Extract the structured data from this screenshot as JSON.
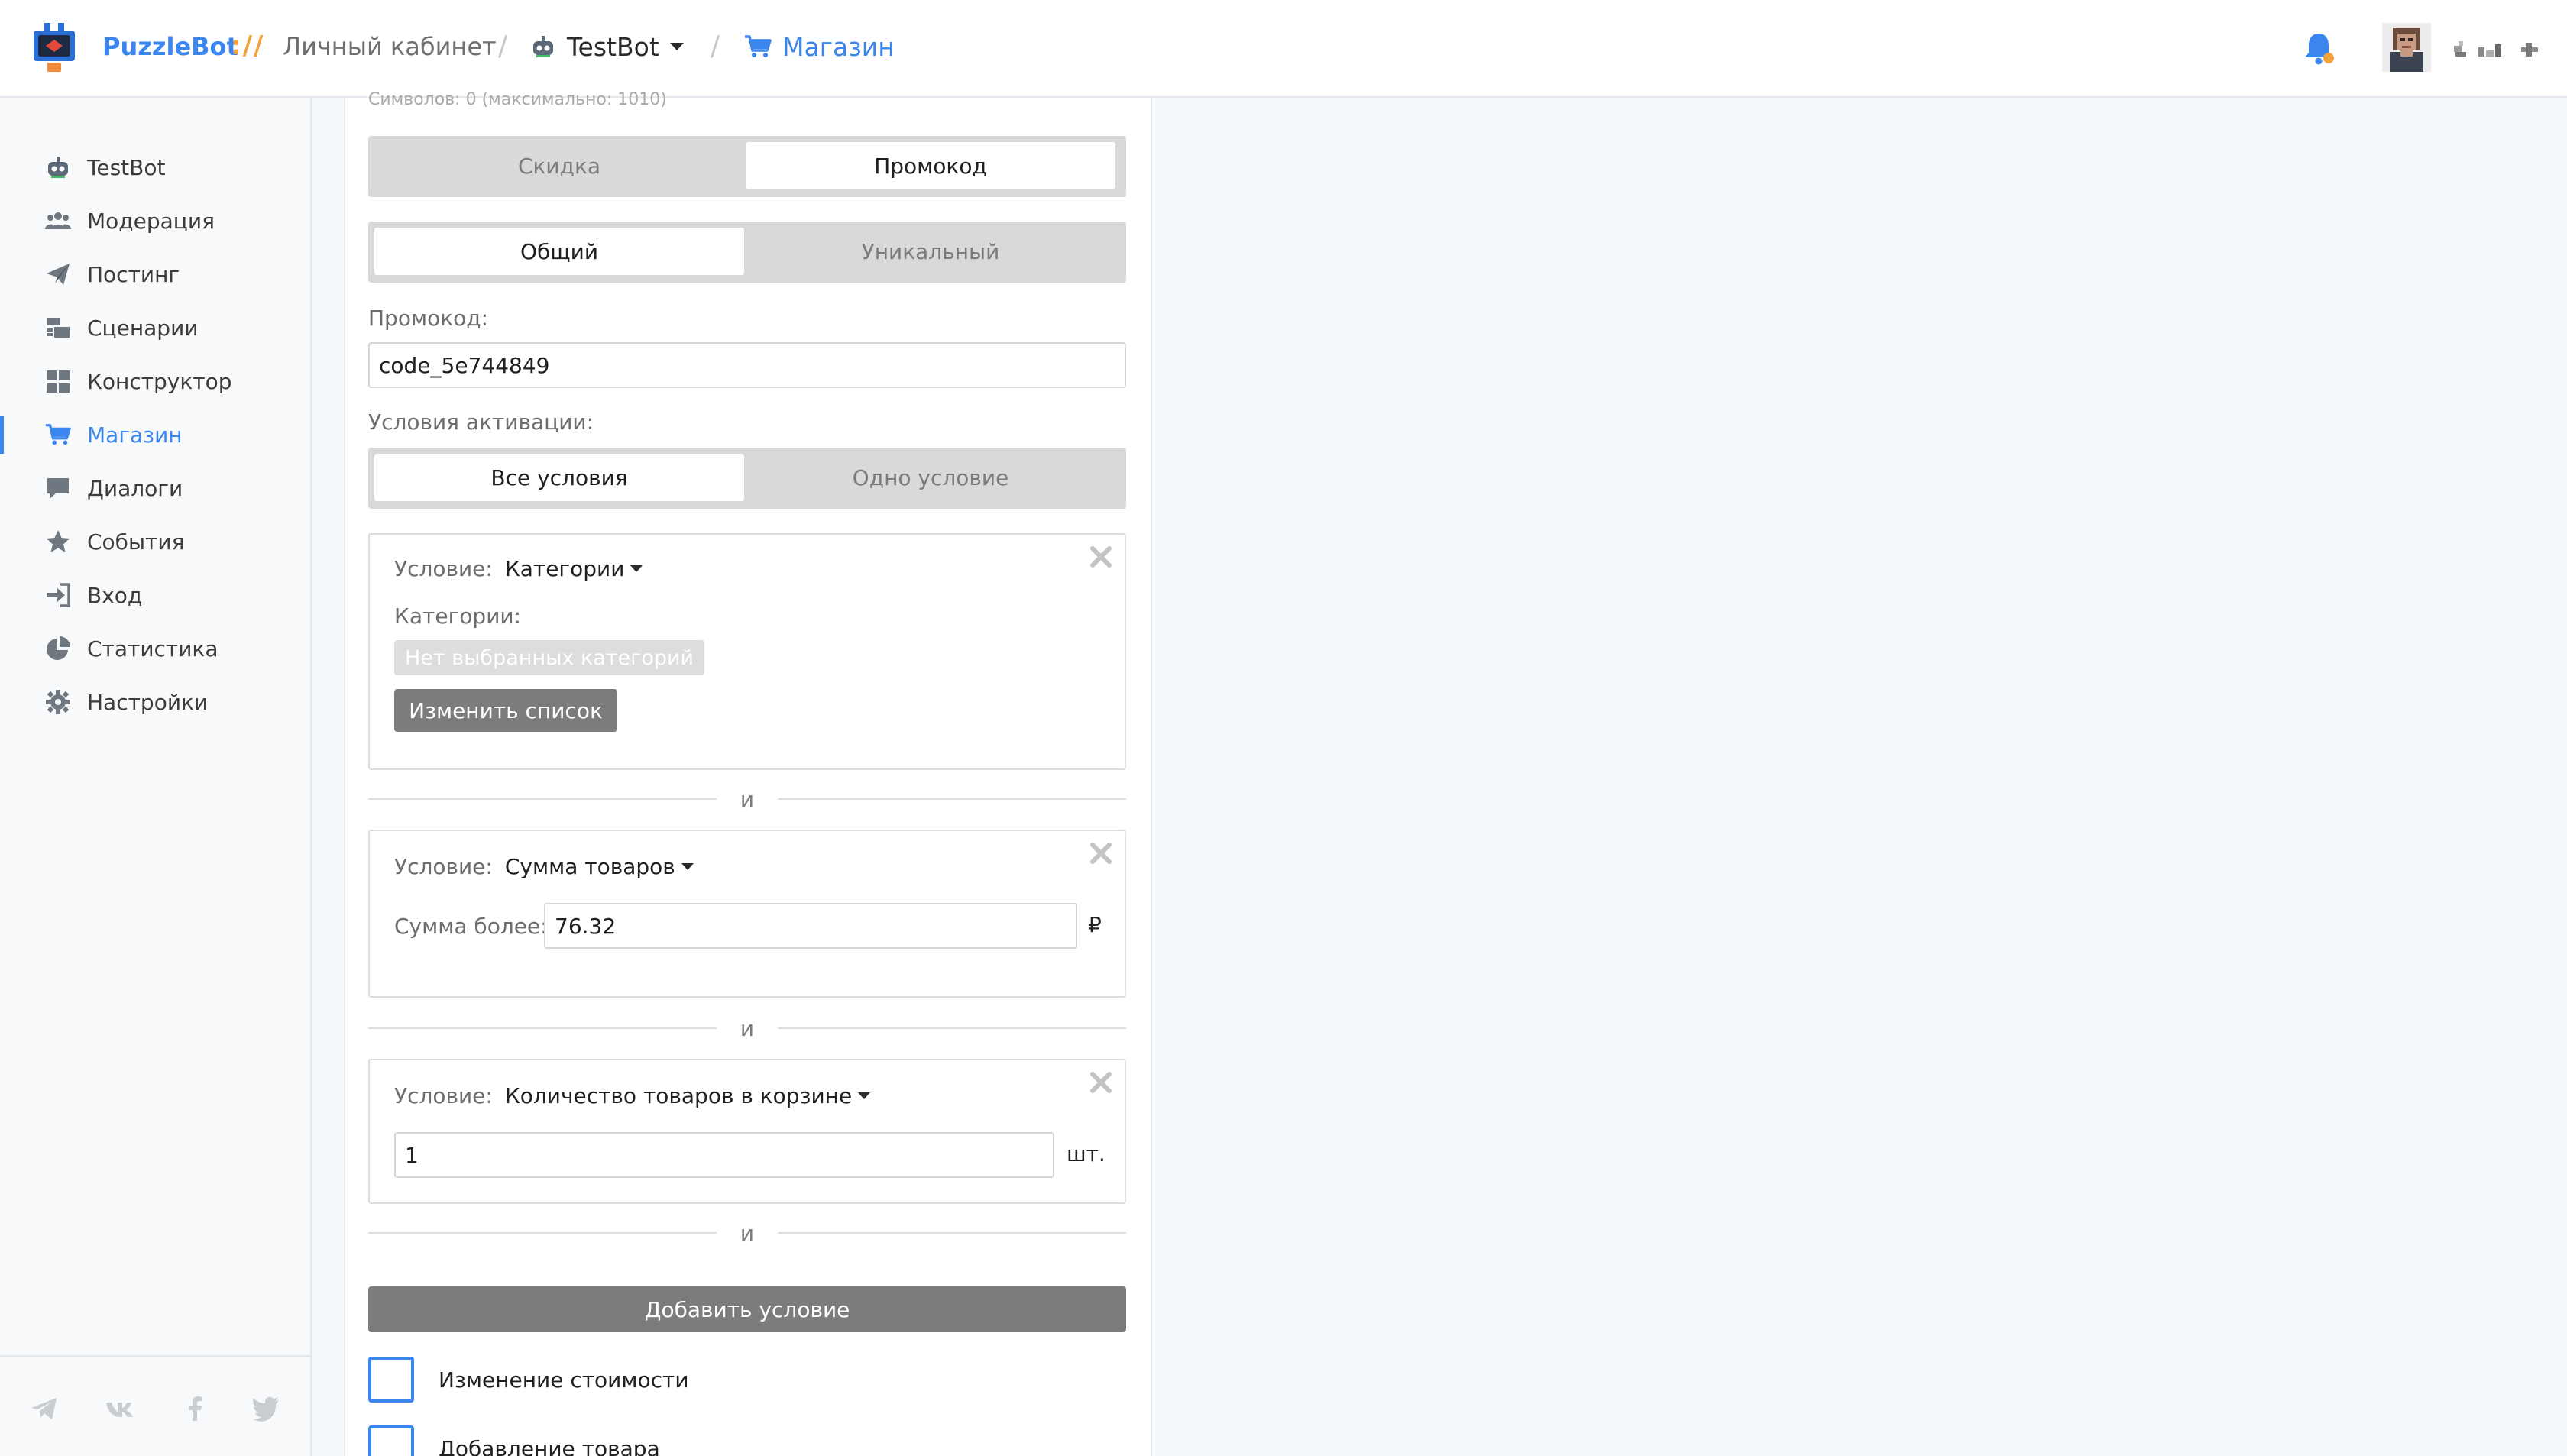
{
  "header": {
    "brand": "PuzzleBot",
    "brand_separator": "://",
    "cabinet": "Личный кабинет",
    "bot_name": "TestBot",
    "section": "Магазин"
  },
  "sidebar": {
    "items": [
      {
        "label": "TestBot",
        "icon": "bot-icon"
      },
      {
        "label": "Модерация",
        "icon": "users-icon"
      },
      {
        "label": "Постинг",
        "icon": "paper-plane-icon"
      },
      {
        "label": "Сценарии",
        "icon": "scenarios-icon"
      },
      {
        "label": "Конструктор",
        "icon": "grid-icon"
      },
      {
        "label": "Магазин",
        "icon": "cart-icon",
        "active": true
      },
      {
        "label": "Диалоги",
        "icon": "chat-icon"
      },
      {
        "label": "События",
        "icon": "star-icon"
      },
      {
        "label": "Вход",
        "icon": "sign-in-icon"
      },
      {
        "label": "Статистика",
        "icon": "pie-chart-icon"
      },
      {
        "label": "Настройки",
        "icon": "gear-icon"
      }
    ],
    "footer_icons": [
      "telegram-icon",
      "vk-icon",
      "facebook-icon",
      "twitter-icon"
    ]
  },
  "form": {
    "char_hint": "Символов: 0 (максимально: 1010)",
    "type_toggle": {
      "discount": "Скидка",
      "promo": "Промокод",
      "selected": "Промокод"
    },
    "scope_toggle": {
      "common": "Общий",
      "unique": "Уникальный",
      "selected": "Общий"
    },
    "promo_label": "Промокод:",
    "promo_value": "code_5e744849",
    "activation_label": "Условия активации:",
    "activation_toggle": {
      "all": "Все условия",
      "one": "Одно условие",
      "selected": "Все условия"
    },
    "conditions": [
      {
        "label": "Условие:",
        "type": "Категории",
        "categories_label": "Категории:",
        "empty_tag": "Нет выбранных категорий",
        "button": "Изменить список"
      },
      {
        "label": "Условие:",
        "type": "Сумма товаров",
        "sum_label": "Сумма более:",
        "sum_value": "76.32",
        "unit": "₽"
      },
      {
        "label": "Условие:",
        "type": "Количество товаров в корзине",
        "qty_value": "1",
        "unit": "шт."
      }
    ],
    "and_word": "и",
    "add_condition": "Добавить условие",
    "checkboxes": [
      {
        "label": "Изменение стоимости",
        "checked": false
      },
      {
        "label": "Добавление товара",
        "checked": false
      }
    ]
  },
  "colors": {
    "accent": "#3a86ee",
    "brand_separator": "#f2a33c",
    "segment_bg": "#d9d9d9",
    "button_gray": "#7c7c7c"
  }
}
